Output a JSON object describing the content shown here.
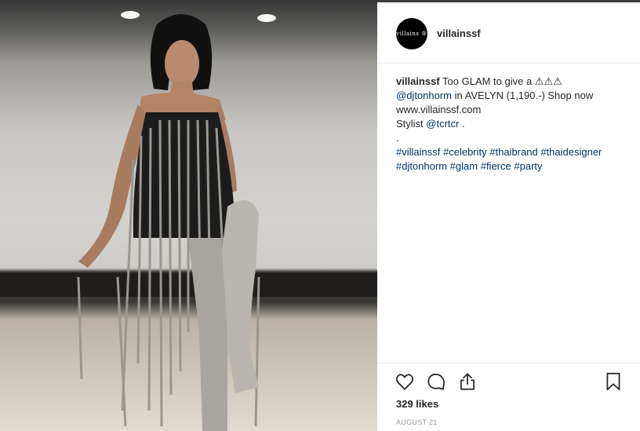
{
  "post": {
    "username": "villainssf",
    "avatar_text": "villains ®",
    "caption": {
      "author": "villainssf",
      "text_1": "Too GLAM to give a ⚠⚠⚠",
      "mention_1": "@djtonhorm",
      "text_2": "in AVELYN (1,190.-) Shop now",
      "text_3": "www.villainssf.com",
      "text_4": "Stylist",
      "mention_2": "@tcrtcr",
      "text_5": ".",
      "text_6": ".",
      "hashtags_line1": [
        "#villainssf",
        "#celebrity",
        "#thaibrand",
        "#thaidesigner"
      ],
      "hashtags_line2": [
        "#djtonhorm",
        "#glam",
        "#fierce",
        "#party"
      ]
    },
    "likes": "329 likes",
    "date": "AUGUST 21"
  },
  "icons": {
    "like": "heart-icon",
    "comment": "comment-icon",
    "share": "share-icon",
    "save": "bookmark-icon"
  },
  "colors": {
    "link": "#003569",
    "text": "#262626",
    "muted": "#999999",
    "divider": "#efefef"
  }
}
